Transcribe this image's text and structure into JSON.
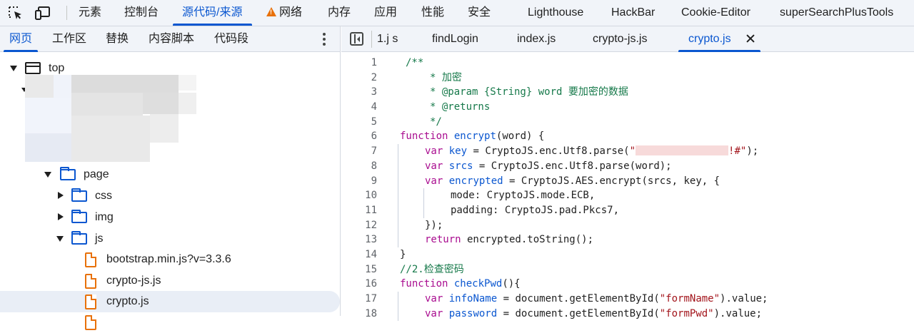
{
  "toolbar": {
    "tabs": [
      "元素",
      "控制台",
      "源代码/来源",
      "网络",
      "内存",
      "应用",
      "性能",
      "安全",
      "Lighthouse",
      "HackBar",
      "Cookie-Editor",
      "superSearchPlusTools"
    ],
    "active_tab": "源代码/来源"
  },
  "navigator": {
    "tabs": [
      "网页",
      "工作区",
      "替换",
      "内容脚本",
      "代码段"
    ],
    "active_tab": "网页",
    "tree": {
      "top": "top",
      "page": "page",
      "css": "css",
      "img": "img",
      "js": "js",
      "files": [
        "bootstrap.min.js?v=3.3.6",
        "crypto-js.js",
        "crypto.js"
      ],
      "selected_file": "crypto.js"
    }
  },
  "editor": {
    "file_tabs": [
      "1.j s",
      "findLogin",
      "index.js",
      "crypto-js.js",
      "crypto.js"
    ],
    "active_file": "crypto.js",
    "line_numbers": [
      "1",
      "2",
      "3",
      "4",
      "5",
      "6",
      "7",
      "8",
      "9",
      "10",
      "11",
      "12",
      "13",
      "14",
      "15",
      "16",
      "17",
      "18"
    ],
    "lines": {
      "l1": "/**",
      "l2": "* 加密",
      "l3": "* @param {String} word 要加密的数据",
      "l4": "* @returns",
      "l5": "*/",
      "l6_kw": "function",
      "l6_fn": "encrypt",
      "l6_rest": "(word) {",
      "l7_kw": "var",
      "l7_var": "key",
      "l7_mid": " = CryptoJS.enc.Utf8.parse(",
      "l7_str_open": "\"",
      "l7_str_tail": "!#\"",
      "l7_end": ");",
      "l8_kw": "var",
      "l8_var": "srcs",
      "l8_rest": " = CryptoJS.enc.Utf8.parse(word);",
      "l9_kw": "var",
      "l9_var": "encrypted",
      "l9_rest": " = CryptoJS.AES.encrypt(srcs, key, {",
      "l10": "mode: CryptoJS.mode.ECB,",
      "l11": "padding: CryptoJS.pad.Pkcs7,",
      "l12": "});",
      "l13_kw": "return",
      "l13_rest": " encrypted.toString();",
      "l14": "}",
      "l15": "//2.检查密码",
      "l16_kw": "function",
      "l16_fn": "checkPwd",
      "l16_rest": "(){",
      "l17_kw": "var",
      "l17_var": "infoName",
      "l17_mid": " = document.getElementById(",
      "l17_str": "\"formName\"",
      "l17_end": ").value;",
      "l18_kw": "var",
      "l18_var": "password",
      "l18_mid": " = document.getElementById(",
      "l18_str": "\"formPwd\"",
      "l18_end": ").value;"
    }
  },
  "colors": {
    "accent": "#0b57d0",
    "keyword": "#a90c8f",
    "string": "#a3151c",
    "comment": "#16794a",
    "file_icon": "#e8710a"
  }
}
